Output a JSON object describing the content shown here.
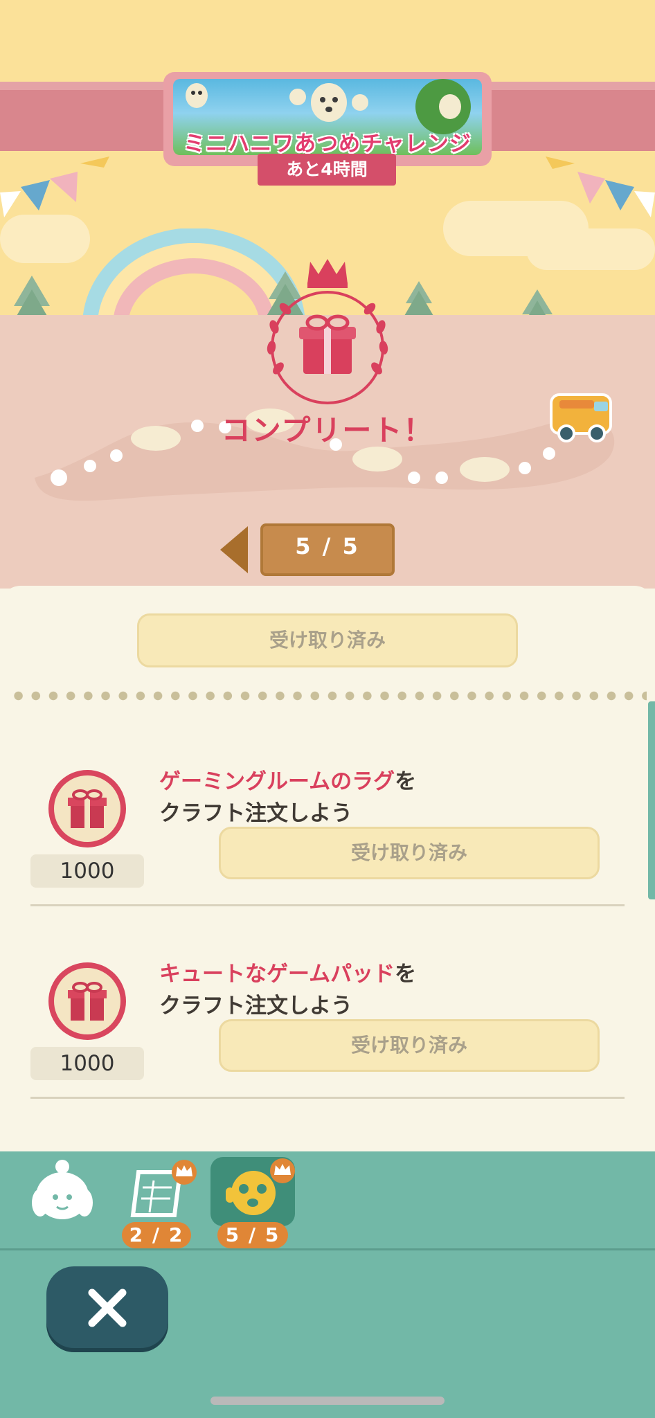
{
  "event": {
    "banner_title": "ミニハニワあつめチャレンジ",
    "time_left": "あと4時間",
    "complete_label": "コンプリート！",
    "page_indicator": "5 / 5"
  },
  "panel": {
    "top_claim_label": "受け取り済み",
    "tasks": [
      {
        "highlight": "ゲーミングルームのラグ",
        "suffix": "を",
        "line2": "クラフト注文しよう",
        "reward": "1000",
        "button_label": "受け取り済み"
      },
      {
        "highlight": "キュートなゲームパッド",
        "suffix": "を",
        "line2": "クラフト注文しよう",
        "reward": "1000",
        "button_label": "受け取り済み"
      }
    ]
  },
  "bottom_nav": {
    "tabs": [
      {
        "icon": "isabelle-icon"
      },
      {
        "icon": "calendar-icon",
        "badge": "2 / 2"
      },
      {
        "icon": "haniwa-icon",
        "badge": "5 / 5"
      }
    ],
    "close_icon": "close-icon"
  },
  "colors": {
    "accent": "#d9405d",
    "nav_bg": "#72b8a7",
    "claimed_btn": "#f8e9b8"
  }
}
